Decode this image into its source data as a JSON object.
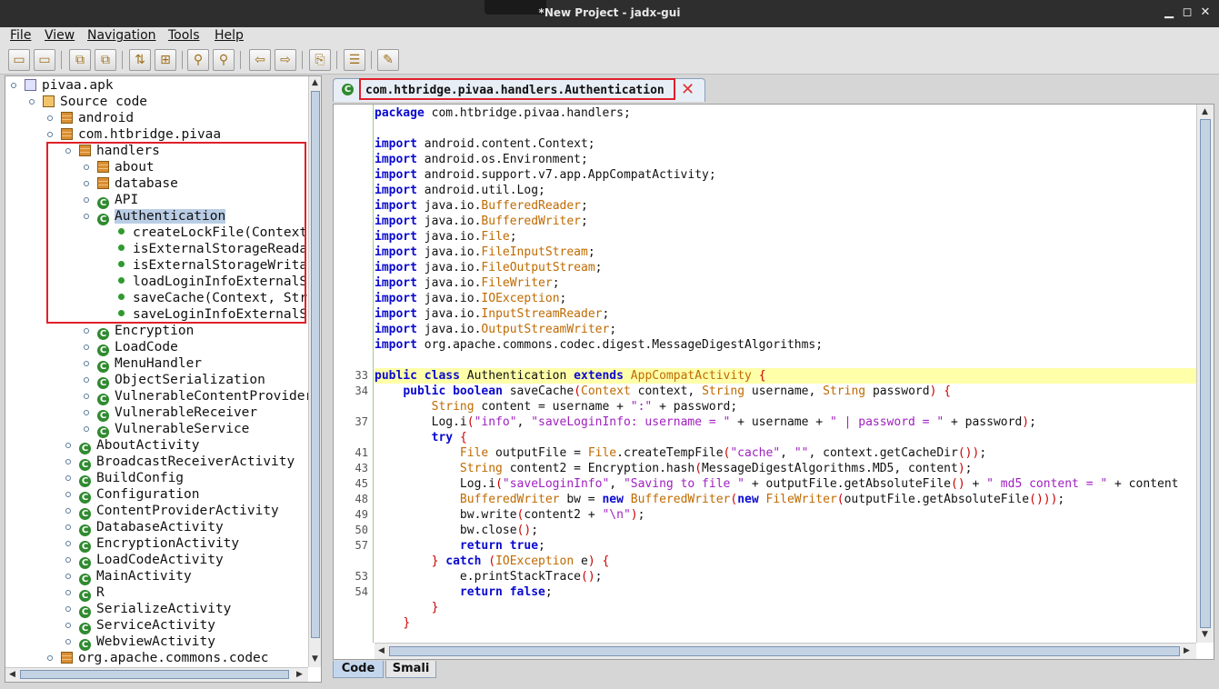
{
  "window": {
    "title": "*New Project - jadx-gui"
  },
  "menu": [
    {
      "label": "File"
    },
    {
      "label": "View"
    },
    {
      "label": "Navigation"
    },
    {
      "label": "Tools"
    },
    {
      "label": "Help"
    }
  ],
  "toolbar": {
    "icons": [
      "open-file-icon",
      "add-files-icon",
      "sync-icon",
      "save-all-icon",
      "export-icon",
      "flatten-icon",
      "search-text-icon",
      "search-class-icon",
      "back-icon",
      "forward-icon",
      "decompile-all-icon",
      "log-icon",
      "preferences-icon"
    ]
  },
  "tree": {
    "nodes": [
      {
        "label": "pivaa.apk",
        "depth": 0,
        "kind": "apk",
        "expanded": true
      },
      {
        "label": "Source code",
        "depth": 1,
        "kind": "src",
        "expanded": true
      },
      {
        "label": "android",
        "depth": 2,
        "kind": "pkg",
        "expanded": false
      },
      {
        "label": "com.htbridge.pivaa",
        "depth": 2,
        "kind": "pkg",
        "expanded": true
      },
      {
        "label": "handlers",
        "depth": 3,
        "kind": "pkg",
        "expanded": true
      },
      {
        "label": "about",
        "depth": 4,
        "kind": "pkg",
        "expanded": false
      },
      {
        "label": "database",
        "depth": 4,
        "kind": "pkg",
        "expanded": false
      },
      {
        "label": "API",
        "depth": 4,
        "kind": "cls",
        "expanded": false
      },
      {
        "label": "Authentication",
        "depth": 4,
        "kind": "cls",
        "expanded": true,
        "selected": true
      },
      {
        "label": "createLockFile(Context,",
        "depth": 5,
        "kind": "mth"
      },
      {
        "label": "isExternalStorageReadab",
        "depth": 5,
        "kind": "mth"
      },
      {
        "label": "isExternalStorageWritab",
        "depth": 5,
        "kind": "mth"
      },
      {
        "label": "loadLoginInfoExternalSt",
        "depth": 5,
        "kind": "mth"
      },
      {
        "label": "saveCache(Context, Stri",
        "depth": 5,
        "kind": "mth"
      },
      {
        "label": "saveLoginInfoExternalSt",
        "depth": 5,
        "kind": "mth"
      },
      {
        "label": "Encryption",
        "depth": 4,
        "kind": "cls",
        "expanded": false
      },
      {
        "label": "LoadCode",
        "depth": 4,
        "kind": "cls",
        "expanded": false
      },
      {
        "label": "MenuHandler",
        "depth": 4,
        "kind": "cls",
        "expanded": false
      },
      {
        "label": "ObjectSerialization",
        "depth": 4,
        "kind": "cls",
        "expanded": false
      },
      {
        "label": "VulnerableContentProvider",
        "depth": 4,
        "kind": "cls",
        "expanded": false
      },
      {
        "label": "VulnerableReceiver",
        "depth": 4,
        "kind": "cls",
        "expanded": false
      },
      {
        "label": "VulnerableService",
        "depth": 4,
        "kind": "cls",
        "expanded": false
      },
      {
        "label": "AboutActivity",
        "depth": 3,
        "kind": "cls",
        "expanded": false
      },
      {
        "label": "BroadcastReceiverActivity",
        "depth": 3,
        "kind": "cls",
        "expanded": false
      },
      {
        "label": "BuildConfig",
        "depth": 3,
        "kind": "cls",
        "expanded": false
      },
      {
        "label": "Configuration",
        "depth": 3,
        "kind": "cls",
        "expanded": false
      },
      {
        "label": "ContentProviderActivity",
        "depth": 3,
        "kind": "cls",
        "expanded": false
      },
      {
        "label": "DatabaseActivity",
        "depth": 3,
        "kind": "cls",
        "expanded": false
      },
      {
        "label": "EncryptionActivity",
        "depth": 3,
        "kind": "cls",
        "expanded": false
      },
      {
        "label": "LoadCodeActivity",
        "depth": 3,
        "kind": "cls",
        "expanded": false
      },
      {
        "label": "MainActivity",
        "depth": 3,
        "kind": "cls",
        "expanded": false
      },
      {
        "label": "R",
        "depth": 3,
        "kind": "cls",
        "expanded": false
      },
      {
        "label": "SerializeActivity",
        "depth": 3,
        "kind": "cls",
        "expanded": false
      },
      {
        "label": "ServiceActivity",
        "depth": 3,
        "kind": "cls",
        "expanded": false
      },
      {
        "label": "WebviewActivity",
        "depth": 3,
        "kind": "cls",
        "expanded": false
      },
      {
        "label": "org.apache.commons.codec",
        "depth": 2,
        "kind": "pkg",
        "expanded": false
      }
    ]
  },
  "editor_tab": {
    "label": "com.htbridge.pivaa.handlers.Authentication",
    "close_glyph": "✕"
  },
  "code": {
    "lines": [
      {
        "n": "",
        "t": "package com.htbridge.pivaa.handlers;"
      },
      {
        "n": "",
        "t": ""
      },
      {
        "n": "",
        "t": "import android.content.Context;"
      },
      {
        "n": "",
        "t": "import android.os.Environment;"
      },
      {
        "n": "",
        "t": "import android.support.v7.app.AppCompatActivity;"
      },
      {
        "n": "",
        "t": "import android.util.Log;"
      },
      {
        "n": "",
        "t": "import java.io.BufferedReader;"
      },
      {
        "n": "",
        "t": "import java.io.BufferedWriter;"
      },
      {
        "n": "",
        "t": "import java.io.File;"
      },
      {
        "n": "",
        "t": "import java.io.FileInputStream;"
      },
      {
        "n": "",
        "t": "import java.io.FileOutputStream;"
      },
      {
        "n": "",
        "t": "import java.io.FileWriter;"
      },
      {
        "n": "",
        "t": "import java.io.IOException;"
      },
      {
        "n": "",
        "t": "import java.io.InputStreamReader;"
      },
      {
        "n": "",
        "t": "import java.io.OutputStreamWriter;"
      },
      {
        "n": "",
        "t": "import org.apache.commons.codec.digest.MessageDigestAlgorithms;"
      },
      {
        "n": "",
        "t": ""
      },
      {
        "n": "33",
        "t": "public class Authentication extends AppCompatActivity {",
        "hl": true
      },
      {
        "n": "34",
        "t": "    public boolean saveCache(Context context, String username, String password) {"
      },
      {
        "n": "",
        "t": "        String content = username + \":\" + password;"
      },
      {
        "n": "37",
        "t": "        Log.i(\"info\", \"saveLoginInfo: username = \" + username + \" | password = \" + password);"
      },
      {
        "n": "",
        "t": "        try {"
      },
      {
        "n": "41",
        "t": "            File outputFile = File.createTempFile(\"cache\", \"\", context.getCacheDir());"
      },
      {
        "n": "43",
        "t": "            String content2 = Encryption.hash(MessageDigestAlgorithms.MD5, content);"
      },
      {
        "n": "45",
        "t": "            Log.i(\"saveLoginInfo\", \"Saving to file \" + outputFile.getAbsoluteFile() + \" md5 content = \" + content"
      },
      {
        "n": "48",
        "t": "            BufferedWriter bw = new BufferedWriter(new FileWriter(outputFile.getAbsoluteFile()));"
      },
      {
        "n": "49",
        "t": "            bw.write(content2 + \"\\n\");"
      },
      {
        "n": "50",
        "t": "            bw.close();"
      },
      {
        "n": "57",
        "t": "            return true;"
      },
      {
        "n": "",
        "t": "        } catch (IOException e) {"
      },
      {
        "n": "53",
        "t": "            e.printStackTrace();"
      },
      {
        "n": "54",
        "t": "            return false;"
      },
      {
        "n": "",
        "t": "        }"
      },
      {
        "n": "",
        "t": "    }"
      }
    ]
  },
  "bottom_tabs": [
    {
      "label": "Code",
      "active": true
    },
    {
      "label": "Smali",
      "active": false
    }
  ],
  "colors": {
    "keyword": "#0a0ad0",
    "type": "#c06a00",
    "string": "#a020c0",
    "highlight": "#ffffaa",
    "annotation_box": "#e0202a",
    "selection": "#b9cde5"
  }
}
